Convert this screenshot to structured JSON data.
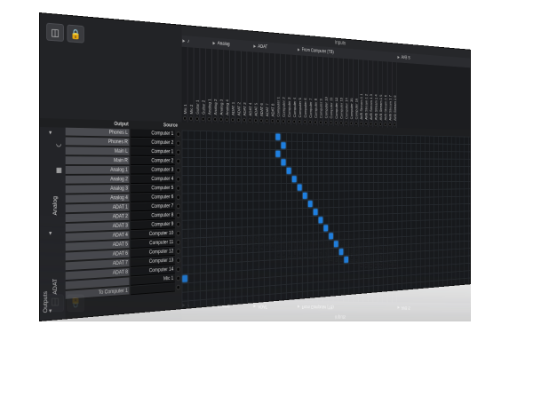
{
  "toolbar": {
    "icons": [
      "window-icon",
      "lock-icon"
    ]
  },
  "inputs_title": "Inputs",
  "groups": [
    {
      "label": "",
      "icon": "tone-icon",
      "col": 0
    },
    {
      "label": "Analog",
      "col": 5
    },
    {
      "label": "ADAT",
      "col": 12
    },
    {
      "label": "From Computer (TB)",
      "col": 20
    },
    {
      "label": "AVB S",
      "col": 40
    }
  ],
  "columns": [
    "Mic 1",
    "Mic 2",
    "Guitar 1",
    "Guitar 2",
    "Analog 1",
    "Analog 2",
    "Analog 3",
    "Analog 4",
    "ADAT 1",
    "ADAT 2",
    "ADAT 3",
    "ADAT 4",
    "ADAT 5",
    "ADAT 6",
    "ADAT 7",
    "ADAT 8",
    "Computer 1",
    "Computer 2",
    "Computer 3",
    "Computer 4",
    "Computer 5",
    "Computer 6",
    "Computer 7",
    "Computer 8",
    "Computer 9",
    "Computer 10",
    "Computer 11",
    "Computer 12",
    "Computer 13",
    "Computer 14",
    "Computer 15",
    "Computer 16",
    "AVB Stream 1 1",
    "AVB Stream 1 2",
    "AVB Stream 1 3",
    "AVB Stream 1 4",
    "AVB Stream 1 5",
    "AVB Stream 1 6",
    "AVB Stream 1 7",
    "AVB Stream 1 8"
  ],
  "headers": {
    "output": "Output",
    "source": "Source"
  },
  "side_labels": {
    "outputs": "Outputs",
    "analog": "Analog",
    "adat": "ADAT"
  },
  "rows": [
    {
      "output": "Phones L",
      "source": "Computer 1"
    },
    {
      "output": "Phones R",
      "source": "Computer 2"
    },
    {
      "output": "Main L",
      "source": "Computer 1"
    },
    {
      "output": "Main R",
      "source": "Computer 2"
    },
    {
      "output": "Analog 1",
      "source": "Computer 3"
    },
    {
      "output": "Analog 2",
      "source": "Computer 4"
    },
    {
      "output": "Analog 3",
      "source": "Computer 5"
    },
    {
      "output": "Analog 4",
      "source": "Computer 6"
    },
    {
      "output": "ADAT 1",
      "source": "Computer 7"
    },
    {
      "output": "ADAT 2",
      "source": "Computer 8"
    },
    {
      "output": "ADAT 3",
      "source": "Computer 9"
    },
    {
      "output": "ADAT 4",
      "source": "Computer 10"
    },
    {
      "output": "ADAT 5",
      "source": "Computer 11"
    },
    {
      "output": "ADAT 6",
      "source": "Computer 12"
    },
    {
      "output": "ADAT 7",
      "source": "Computer 13"
    },
    {
      "output": "ADAT 8",
      "source": "Computer 14"
    },
    {
      "output": "",
      "source": "Mic 1"
    },
    {
      "output": "To Computer 1",
      "source": ""
    }
  ],
  "routes": [
    {
      "row": 0,
      "col": 16
    },
    {
      "row": 1,
      "col": 17
    },
    {
      "row": 2,
      "col": 16
    },
    {
      "row": 3,
      "col": 17
    },
    {
      "row": 4,
      "col": 18
    },
    {
      "row": 5,
      "col": 19
    },
    {
      "row": 6,
      "col": 20
    },
    {
      "row": 7,
      "col": 21
    },
    {
      "row": 8,
      "col": 22
    },
    {
      "row": 9,
      "col": 23
    },
    {
      "row": 10,
      "col": 24
    },
    {
      "row": 11,
      "col": 25
    },
    {
      "row": 12,
      "col": 26
    },
    {
      "row": 13,
      "col": 27
    },
    {
      "row": 14,
      "col": 28
    },
    {
      "row": 15,
      "col": 29
    },
    {
      "row": 16,
      "col": 0
    }
  ],
  "colors": {
    "route": "#1e7fe0",
    "background": "#1e1f21",
    "output_cell": "#4a4b50"
  }
}
